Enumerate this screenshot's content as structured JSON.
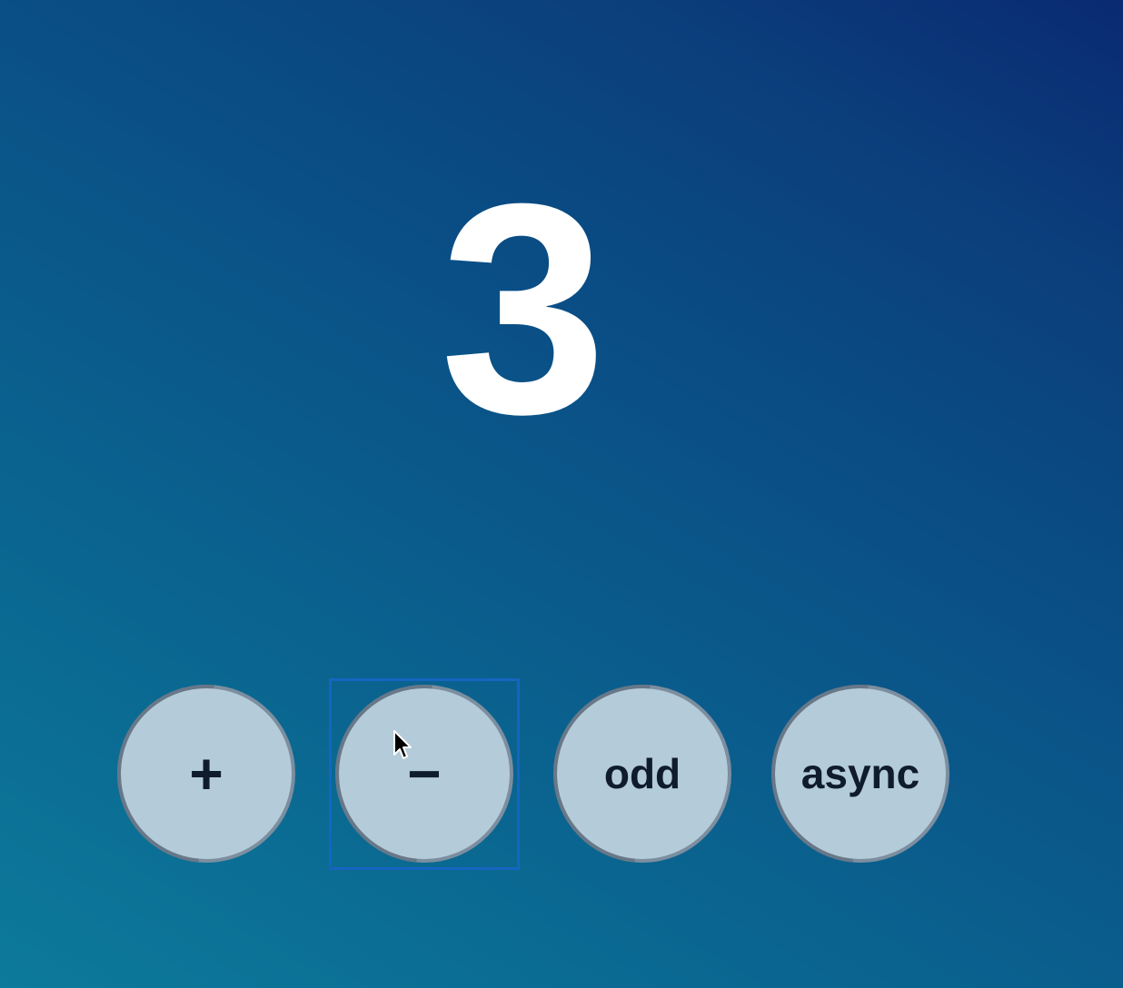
{
  "counter": {
    "value": "3"
  },
  "buttons": {
    "increment_label": "+",
    "decrement_label": "−",
    "odd_label": "odd",
    "async_label": "async"
  },
  "colors": {
    "background_top_right": "#0a2a72",
    "background_bottom_left": "#0d7a9b",
    "button_fill": "#b4cbd9",
    "button_text": "#0f1c2c",
    "counter_text": "#ffffff",
    "focus_ring": "#1565c0"
  },
  "icons": {
    "cursor": "arrow-pointer-icon"
  }
}
